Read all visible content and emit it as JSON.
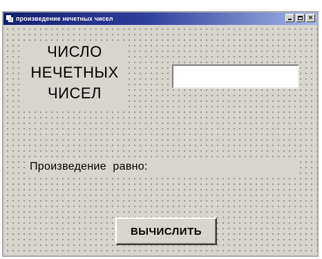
{
  "window": {
    "title": "произведение нечетных чисел",
    "controls": {
      "minimize": "_",
      "maximize": "□",
      "close": "×"
    }
  },
  "form": {
    "count_label_lines": [
      "ЧИСЛО",
      "НЕЧЕТНЫХ",
      "ЧИСЕЛ"
    ],
    "count_input": {
      "value": "",
      "placeholder": ""
    },
    "result_label": "Произведение  равно:",
    "calculate_button": "ВЫЧИСЛИТЬ"
  }
}
